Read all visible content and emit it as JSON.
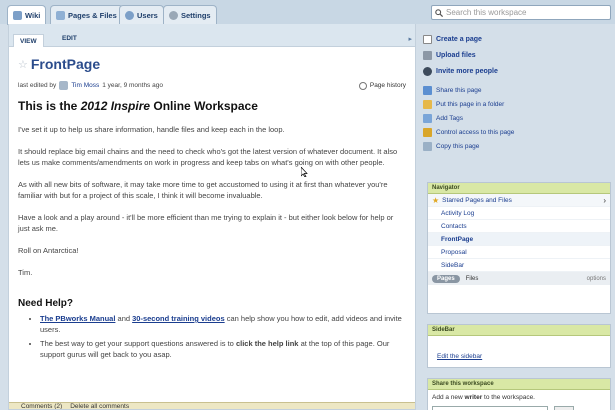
{
  "tabs": [
    {
      "label": "Wiki",
      "icon": "wiki-icon"
    },
    {
      "label": "Pages & Files",
      "icon": "pages-icon"
    },
    {
      "label": "Users",
      "icon": "users-icon"
    },
    {
      "label": "Settings",
      "icon": "gear-icon"
    }
  ],
  "search": {
    "placeholder": "Search this workspace"
  },
  "subtabs": {
    "view": "VIEW",
    "edit": "EDIT"
  },
  "page": {
    "title": "FrontPage",
    "edited_prefix": "last edited by",
    "editor": "Tim Moss",
    "edited_time": "1 year, 9 months ago",
    "history_label": "Page history",
    "heading_prefix": "This is the ",
    "heading_em": "2012 Inspire",
    "heading_suffix": " Online Workspace",
    "paragraphs": [
      "I've set it up to help us share information, handle files and keep each in the loop.",
      "It should replace big email chains and the need to check who's got the latest version of whatever document. It also lets us make comments/amendments on work in progress and keep tabs on what's going on with other people.",
      "As with all new bits of software, it may take more time to get accustomed to using it at first than whatever you're familiar with but for a project of this scale, I think it will become invaluable.",
      "Have a look and a play around - it'll be more efficient than me trying to explain it - but either look below for help or just ask me.",
      "Roll on Antarctica!",
      "Tim."
    ],
    "help_title": "Need Help?",
    "help_1_link_a": "The PBworks Manual",
    "help_1_and": " and ",
    "help_1_link_b": "30-second training videos",
    "help_1_rest": " can help show you how to edit, add videos and invite users.",
    "help_2_pre": "The best way to get your support questions answered is to ",
    "help_2_bold": "click the help link",
    "help_2_rest": " at the top of this page. Our support gurus will get back to you asap.",
    "comments_label": "Comments (2)",
    "delete_comments": "Delete all comments"
  },
  "actions": {
    "create": "Create a page",
    "upload": "Upload files",
    "invite": "Invite more people"
  },
  "page_actions": [
    {
      "label": "Share this page",
      "color": "#5b8fd1"
    },
    {
      "label": "Put this page in a folder",
      "color": "#e6b84a"
    },
    {
      "label": "Add Tags",
      "color": "#7aa5d8"
    },
    {
      "label": "Control access to this page",
      "color": "#d9a62a"
    },
    {
      "label": "Copy this page",
      "color": "#9ab0c6"
    }
  ],
  "navigator": {
    "title": "Navigator",
    "starred": "Starred Pages and Files",
    "items": [
      "Activity Log",
      "Contacts",
      "FrontPage",
      "Proposal",
      "SideBar"
    ],
    "current": "FrontPage",
    "pages_tab": "Pages",
    "files_tab": "Files",
    "options": "options"
  },
  "sidebar_panel": {
    "title": "SideBar",
    "link": "Edit the sidebar"
  },
  "share_panel": {
    "title": "Share this workspace",
    "add_prefix": "Add a new ",
    "add_bold": "writer",
    "add_suffix": " to the workspace."
  },
  "colors": {
    "accent_link": "#1a3d8f",
    "panel_head": "#d9e8a5",
    "title": "#2b4c8c"
  }
}
